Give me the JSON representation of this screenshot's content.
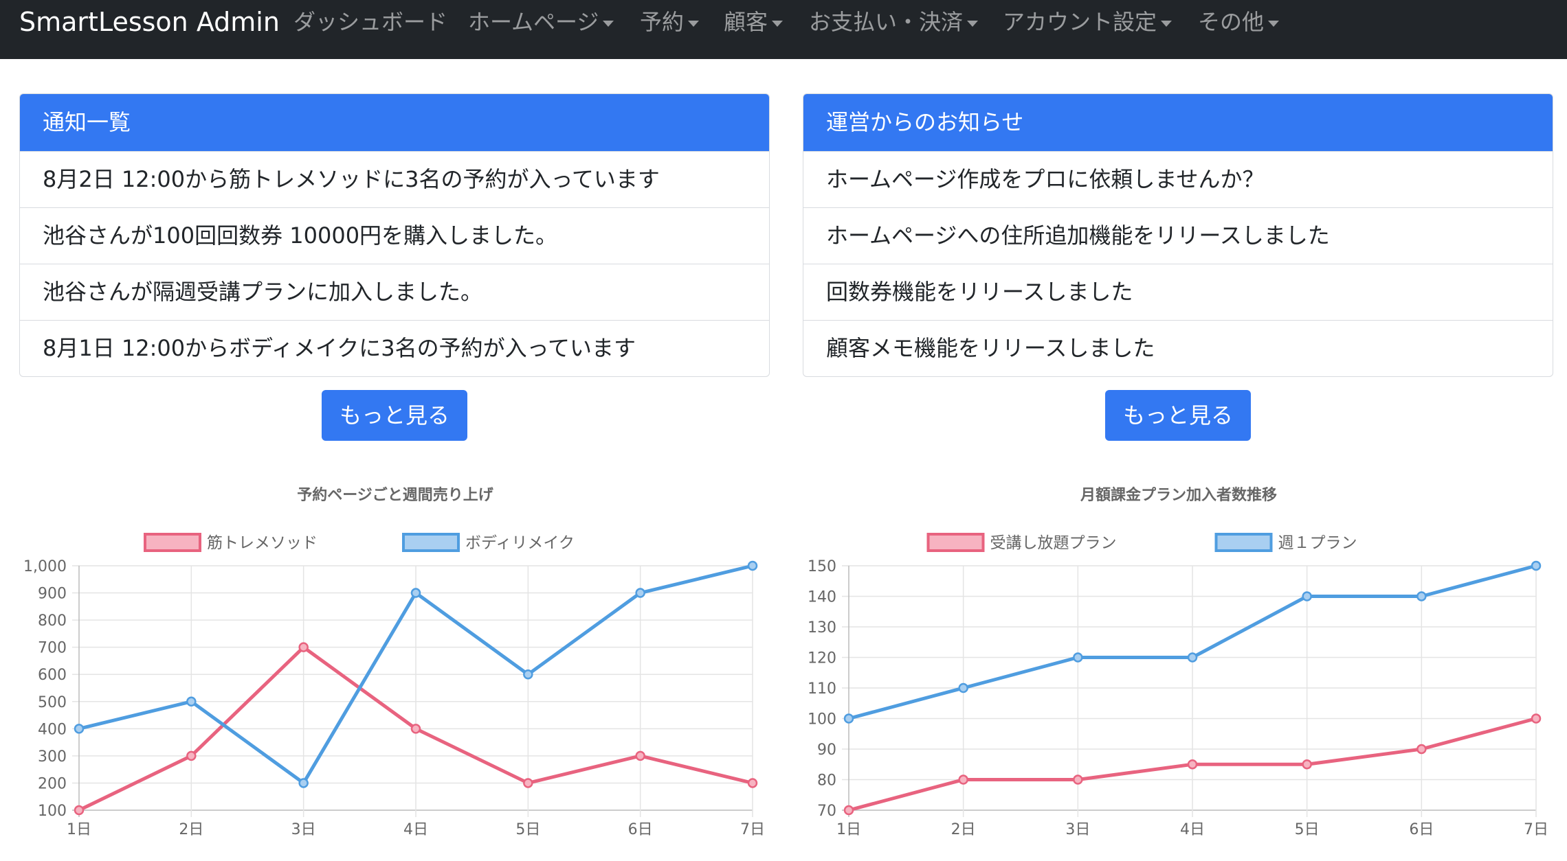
{
  "navbar": {
    "brand": "SmartLesson Admin",
    "items": [
      {
        "label": "ダッシュボード",
        "dropdown": false
      },
      {
        "label": "ホームページ",
        "dropdown": true
      },
      {
        "label": "予約",
        "dropdown": true
      },
      {
        "label": "顧客",
        "dropdown": true
      },
      {
        "label": "お支払い・決済",
        "dropdown": true
      },
      {
        "label": "アカウント設定",
        "dropdown": true
      },
      {
        "label": "その他",
        "dropdown": true
      }
    ]
  },
  "notifications": {
    "title": "通知一覧",
    "items": [
      "8月2日 12:00から筋トレメソッドに3名の予約が入っています",
      "池谷さんが100回回数券 10000円を購入しました。",
      "池谷さんが隔週受講プランに加入しました。",
      "8月1日 12:00からボディメイクに3名の予約が入っています"
    ],
    "more_label": "もっと見る"
  },
  "announcements": {
    "title": "運営からのお知らせ",
    "items": [
      "ホームページ作成をプロに依頼しませんか？",
      "ホームページへの住所追加機能をリリースしました",
      "回数券機能をリリースしました",
      "顧客メモ機能をリリースしました"
    ],
    "more_label": "もっと見る"
  },
  "colors": {
    "navbar_bg": "#212529",
    "primary": "#3378f2",
    "series_red": "#e8637f",
    "series_red_fill": "#f7b3c1",
    "series_blue": "#4f9de0",
    "series_blue_fill": "#a9cff1"
  },
  "chart_data": [
    {
      "type": "line",
      "title": "予約ページごと週間売り上げ",
      "categories": [
        "1日",
        "2日",
        "3日",
        "4日",
        "5日",
        "6日",
        "7日"
      ],
      "series": [
        {
          "name": "筋トレメソッド",
          "values": [
            100,
            300,
            700,
            400,
            200,
            300,
            200
          ],
          "color": "#e8637f",
          "fill": "#f7b3c1"
        },
        {
          "name": "ボディリメイク",
          "values": [
            400,
            500,
            200,
            900,
            600,
            900,
            1000
          ],
          "color": "#4f9de0",
          "fill": "#a9cff1"
        }
      ],
      "ylim": [
        100,
        1000
      ],
      "yticks": [
        "1,000",
        "900",
        "800",
        "700",
        "600",
        "500",
        "400",
        "300",
        "200",
        "100"
      ],
      "grid": true,
      "legend": "top-center"
    },
    {
      "type": "line",
      "title": "月額課金プラン加入者数推移",
      "categories": [
        "1日",
        "2日",
        "3日",
        "4日",
        "5日",
        "6日",
        "7日"
      ],
      "series": [
        {
          "name": "受講し放題プラン",
          "values": [
            70,
            80,
            80,
            85,
            85,
            90,
            100
          ],
          "color": "#e8637f",
          "fill": "#f7b3c1"
        },
        {
          "name": "週１プラン",
          "values": [
            100,
            110,
            120,
            120,
            140,
            140,
            150
          ],
          "color": "#4f9de0",
          "fill": "#a9cff1"
        }
      ],
      "ylim": [
        70,
        150
      ],
      "yticks": [
        "150",
        "140",
        "130",
        "120",
        "110",
        "100",
        "90",
        "80",
        "70"
      ],
      "grid": true,
      "legend": "top-center"
    }
  ]
}
